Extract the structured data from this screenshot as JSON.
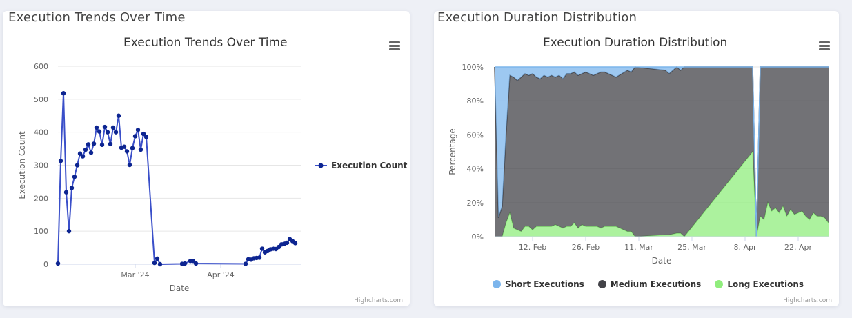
{
  "cards": {
    "left_title": "Execution Trends Over Time",
    "right_title": "Execution Duration Distribution"
  },
  "credits": "Highcharts.com",
  "colors": {
    "line": "#3a4fc9",
    "marker": "#0d2591",
    "short": "#7cb5ec",
    "medium": "#434348",
    "long": "#90ed7d",
    "grid": "#e6e6e6"
  },
  "chart_data": [
    {
      "type": "line",
      "title": "Execution Trends Over Time",
      "xlabel": "Date",
      "ylabel": "Execution Count",
      "ylim": [
        0,
        600
      ],
      "xlim": [
        "2024-02-02",
        "2024-04-30"
      ],
      "grid": true,
      "legend_position": "right",
      "yticks": [
        "0",
        "100",
        "200",
        "300",
        "400",
        "500",
        "600"
      ],
      "xticks": [
        {
          "date": "2024-03-01",
          "label": "Mar '24"
        },
        {
          "date": "2024-04-01",
          "label": "Apr '24"
        }
      ],
      "series": [
        {
          "name": "Execution Count",
          "points": [
            [
              "2024-02-02",
              2
            ],
            [
              "2024-02-03",
              313
            ],
            [
              "2024-02-04",
              518
            ],
            [
              "2024-02-05",
              218
            ],
            [
              "2024-02-06",
              100
            ],
            [
              "2024-02-07",
              231
            ],
            [
              "2024-02-08",
              265
            ],
            [
              "2024-02-09",
              300
            ],
            [
              "2024-02-10",
              335
            ],
            [
              "2024-02-11",
              327
            ],
            [
              "2024-02-12",
              347
            ],
            [
              "2024-02-13",
              363
            ],
            [
              "2024-02-14",
              338
            ],
            [
              "2024-02-15",
              365
            ],
            [
              "2024-02-16",
              414
            ],
            [
              "2024-02-17",
              402
            ],
            [
              "2024-02-18",
              362
            ],
            [
              "2024-02-19",
              416
            ],
            [
              "2024-02-20",
              400
            ],
            [
              "2024-02-21",
              364
            ],
            [
              "2024-02-22",
              414
            ],
            [
              "2024-02-23",
              400
            ],
            [
              "2024-02-24",
              450
            ],
            [
              "2024-02-25",
              353
            ],
            [
              "2024-02-26",
              356
            ],
            [
              "2024-02-27",
              342
            ],
            [
              "2024-02-28",
              301
            ],
            [
              "2024-02-29",
              352
            ],
            [
              "2024-03-01",
              388
            ],
            [
              "2024-03-02",
              407
            ],
            [
              "2024-03-03",
              347
            ],
            [
              "2024-03-04",
              395
            ],
            [
              "2024-03-05",
              386
            ],
            [
              "2024-03-08",
              4
            ],
            [
              "2024-03-09",
              17
            ],
            [
              "2024-03-10",
              0
            ],
            [
              "2024-03-18",
              1
            ],
            [
              "2024-03-19",
              2
            ],
            [
              "2024-03-21",
              10
            ],
            [
              "2024-03-22",
              10
            ],
            [
              "2024-03-23",
              2
            ],
            [
              "2024-04-10",
              1
            ],
            [
              "2024-04-11",
              15
            ],
            [
              "2024-04-12",
              14
            ],
            [
              "2024-04-13",
              18
            ],
            [
              "2024-04-14",
              19
            ],
            [
              "2024-04-15",
              20
            ],
            [
              "2024-04-16",
              47
            ],
            [
              "2024-04-17",
              36
            ],
            [
              "2024-04-18",
              40
            ],
            [
              "2024-04-19",
              45
            ],
            [
              "2024-04-20",
              47
            ],
            [
              "2024-04-21",
              46
            ],
            [
              "2024-04-22",
              52
            ],
            [
              "2024-04-23",
              60
            ],
            [
              "2024-04-24",
              62
            ],
            [
              "2024-04-25",
              65
            ],
            [
              "2024-04-26",
              76
            ],
            [
              "2024-04-27",
              70
            ],
            [
              "2024-04-28",
              64
            ]
          ]
        }
      ]
    },
    {
      "type": "area",
      "stacking": "percent",
      "title": "Execution Duration Distribution",
      "xlabel": "Date",
      "ylabel": "Percentage",
      "ylim": [
        0,
        100
      ],
      "xlim": [
        "2024-02-02",
        "2024-04-30"
      ],
      "grid": true,
      "legend_position": "bottom",
      "yticks": [
        "0%",
        "20%",
        "40%",
        "60%",
        "80%",
        "100%"
      ],
      "xticks": [
        {
          "date": "2024-02-12",
          "label": "12. Feb"
        },
        {
          "date": "2024-02-26",
          "label": "26. Feb"
        },
        {
          "date": "2024-03-11",
          "label": "11. Mar"
        },
        {
          "date": "2024-03-25",
          "label": "25. Mar"
        },
        {
          "date": "2024-04-08",
          "label": "8. Apr"
        },
        {
          "date": "2024-04-22",
          "label": "22. Apr"
        }
      ],
      "dates": [
        "2024-02-02",
        "2024-02-03",
        "2024-02-04",
        "2024-02-05",
        "2024-02-06",
        "2024-02-07",
        "2024-02-08",
        "2024-02-09",
        "2024-02-10",
        "2024-02-11",
        "2024-02-12",
        "2024-02-13",
        "2024-02-14",
        "2024-02-15",
        "2024-02-16",
        "2024-02-17",
        "2024-02-18",
        "2024-02-19",
        "2024-02-20",
        "2024-02-21",
        "2024-02-22",
        "2024-02-23",
        "2024-02-24",
        "2024-02-25",
        "2024-02-26",
        "2024-02-27",
        "2024-02-28",
        "2024-02-29",
        "2024-03-01",
        "2024-03-02",
        "2024-03-03",
        "2024-03-04",
        "2024-03-05",
        "2024-03-08",
        "2024-03-09",
        "2024-03-10",
        "2024-03-18",
        "2024-03-19",
        "2024-03-21",
        "2024-03-22",
        "2024-03-23",
        "2024-04-10",
        "2024-04-11",
        "2024-04-12",
        "2024-04-13",
        "2024-04-14",
        "2024-04-15",
        "2024-04-16",
        "2024-04-17",
        "2024-04-18",
        "2024-04-19",
        "2024-04-20",
        "2024-04-21",
        "2024-04-22",
        "2024-04-23",
        "2024-04-24",
        "2024-04-25",
        "2024-04-26",
        "2024-04-27",
        "2024-04-28",
        "2024-04-29",
        "2024-04-30"
      ],
      "series": [
        {
          "name": "Short Executions",
          "values": [
            0,
            89,
            82,
            40,
            5,
            6,
            8,
            6,
            4,
            5,
            4,
            6,
            7,
            5,
            6,
            5,
            6,
            5,
            7,
            4,
            4,
            3,
            5,
            4,
            3,
            4,
            5,
            4,
            3,
            3,
            4,
            5,
            6,
            2,
            3,
            0,
            2,
            4,
            0,
            2,
            0,
            0,
            0,
            0,
            0,
            0,
            0,
            0,
            0,
            0,
            0,
            0,
            0,
            0,
            0,
            0,
            0,
            0,
            0,
            0,
            0,
            0
          ]
        },
        {
          "name": "Medium Executions",
          "values": [
            100,
            11,
            18,
            52,
            81,
            89,
            88,
            91,
            90,
            89,
            92,
            88,
            87,
            89,
            88,
            89,
            87,
            89,
            88,
            90,
            90,
            89,
            90,
            89,
            91,
            90,
            89,
            90,
            92,
            91,
            90,
            89,
            88,
            95,
            94,
            100,
            97,
            95,
            98,
            96,
            100,
            50,
            0,
            88,
            90,
            80,
            85,
            83,
            86,
            82,
            88,
            84,
            87,
            86,
            85,
            88,
            90,
            86,
            88,
            88,
            89,
            92
          ]
        },
        {
          "name": "Long Executions",
          "values": [
            0,
            0,
            0,
            8,
            14,
            5,
            4,
            3,
            6,
            6,
            4,
            6,
            6,
            6,
            6,
            6,
            7,
            6,
            5,
            6,
            6,
            8,
            5,
            7,
            6,
            6,
            6,
            6,
            5,
            6,
            6,
            6,
            6,
            3,
            3,
            0,
            1,
            1,
            2,
            2,
            0,
            50,
            0,
            12,
            10,
            20,
            15,
            17,
            14,
            18,
            12,
            16,
            13,
            14,
            15,
            12,
            10,
            14,
            12,
            12,
            11,
            8
          ]
        }
      ]
    }
  ]
}
